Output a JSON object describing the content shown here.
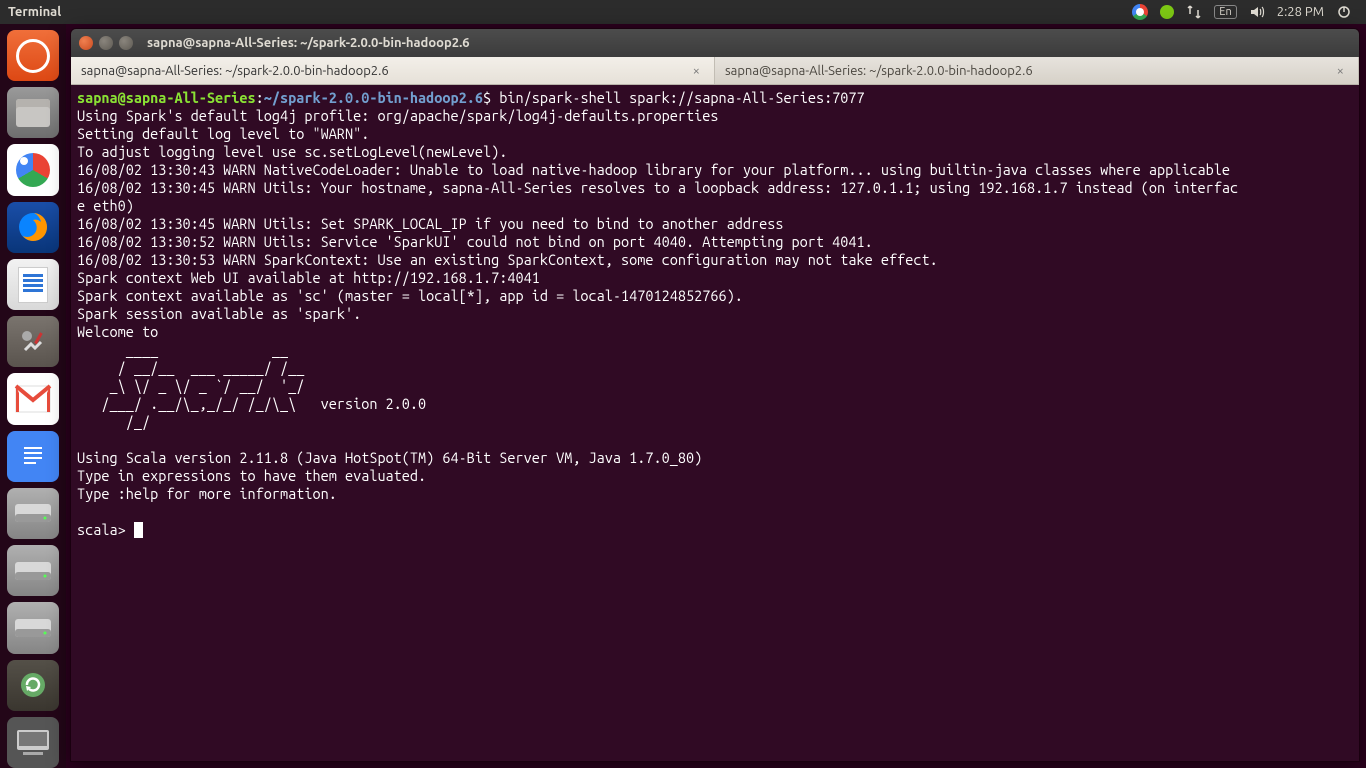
{
  "panel": {
    "app_menu": "Terminal",
    "lang": "En",
    "time": "2:28 PM"
  },
  "window": {
    "title": "sapna@sapna-All-Series: ~/spark-2.0.0-bin-hadoop2.6",
    "tabs": [
      {
        "label": "sapna@sapna-All-Series: ~/spark-2.0.0-bin-hadoop2.6",
        "close": "×"
      },
      {
        "label": "sapna@sapna-All-Series: ~/spark-2.0.0-bin-hadoop2.6",
        "close": "×"
      }
    ]
  },
  "terminal": {
    "prompt_user": "sapna@sapna-All-Series",
    "prompt_colon": ":",
    "prompt_path": "~/spark-2.0.0-bin-hadoop2.6",
    "prompt_dollar": "$ ",
    "command": "bin/spark-shell spark://sapna-All-Series:7077",
    "output": "Using Spark's default log4j profile: org/apache/spark/log4j-defaults.properties\nSetting default log level to \"WARN\".\nTo adjust logging level use sc.setLogLevel(newLevel).\n16/08/02 13:30:43 WARN NativeCodeLoader: Unable to load native-hadoop library for your platform... using builtin-java classes where applicable\n16/08/02 13:30:45 WARN Utils: Your hostname, sapna-All-Series resolves to a loopback address: 127.0.1.1; using 192.168.1.7 instead (on interfac\ne eth0)\n16/08/02 13:30:45 WARN Utils: Set SPARK_LOCAL_IP if you need to bind to another address\n16/08/02 13:30:52 WARN Utils: Service 'SparkUI' could not bind on port 4040. Attempting port 4041.\n16/08/02 13:30:53 WARN SparkContext: Use an existing SparkContext, some configuration may not take effect.\nSpark context Web UI available at http://192.168.1.7:4041\nSpark context available as 'sc' (master = local[*], app id = local-1470124852766).\nSpark session available as 'spark'.\nWelcome to\n      ____              __\n     / __/__  ___ _____/ /__\n    _\\ \\/ _ \\/ _ `/ __/  '_/\n   /___/ .__/\\_,_/_/ /_/\\_\\   version 2.0.0\n      /_/\n\nUsing Scala version 2.11.8 (Java HotSpot(TM) 64-Bit Server VM, Java 1.7.0_80)\nType in expressions to have them evaluated.\nType :help for more information.\n",
    "scala_prompt": "scala> "
  }
}
